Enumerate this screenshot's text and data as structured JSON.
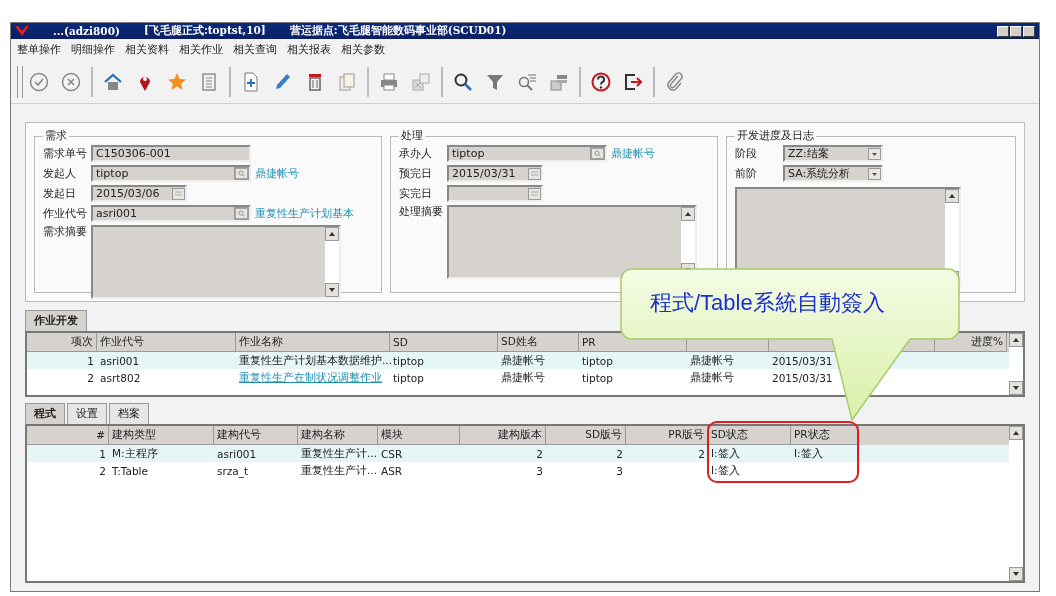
{
  "window": {
    "title": [
      "...(adzi800)",
      "[飞毛腿正式:toptst,10]",
      "营运据点:飞毛腿智能数码事业部(SCUD01)"
    ]
  },
  "menu": [
    "整单操作",
    "明细操作",
    "相关资料",
    "相关作业",
    "相关查询",
    "相关报表",
    "相关参数"
  ],
  "toolbar": [
    [
      {
        "kind": "confirm"
      },
      {
        "kind": "cancel"
      }
    ],
    [
      {
        "kind": "home"
      },
      {
        "kind": "pin"
      },
      {
        "kind": "star"
      },
      {
        "kind": "list"
      }
    ],
    [
      {
        "kind": "add"
      },
      {
        "kind": "edit"
      },
      {
        "kind": "delete"
      },
      {
        "kind": "copy"
      }
    ],
    [
      {
        "kind": "print"
      },
      {
        "kind": "export"
      }
    ],
    [
      {
        "kind": "search"
      },
      {
        "kind": "filter"
      },
      {
        "kind": "query-list"
      },
      {
        "kind": "stack"
      }
    ],
    [
      {
        "kind": "help"
      },
      {
        "kind": "exit"
      }
    ],
    [
      {
        "kind": "attach"
      }
    ]
  ],
  "sections": [
    {
      "title": "需求",
      "fields": [
        {
          "kind": "text",
          "label": "需求单号",
          "value": "C150306-001"
        },
        {
          "kind": "lookup",
          "label": "发起人",
          "value": "tiptop",
          "link": "鼎捷帐号"
        },
        {
          "kind": "date",
          "label": "发起日",
          "value": "2015/03/06"
        },
        {
          "kind": "lookup",
          "label": "作业代号",
          "value": "asri001",
          "link": "重复性生产计划基本"
        },
        {
          "kind": "memo",
          "label": "需求摘要"
        }
      ]
    },
    {
      "title": "处理",
      "fields": [
        {
          "kind": "lookup",
          "label": "承办人",
          "value": "tiptop",
          "link": "鼎捷帐号"
        },
        {
          "kind": "date",
          "label": "预完日",
          "value": "2015/03/31"
        },
        {
          "kind": "date",
          "label": "实完日"
        },
        {
          "kind": "memo",
          "label": "处理摘要"
        }
      ]
    },
    {
      "title": "开发进度及日志",
      "fields": [
        {
          "kind": "select",
          "label": "阶段",
          "value": "ZZ:结案"
        },
        {
          "kind": "select",
          "label": "前阶",
          "value": "SA:系统分析"
        },
        {
          "kind": "memo"
        }
      ]
    }
  ],
  "job_tabs": [
    {
      "label": "作业开发",
      "selected": true
    }
  ],
  "job_table": {
    "columns": [
      "项次",
      "作业代号",
      "作业名称",
      "SD",
      "SD姓名",
      "PR",
      "",
      "",
      "",
      "进度%"
    ],
    "rows": [
      {
        "selected": true,
        "cells": [
          "1",
          "asri001",
          "重复性生产计划基本数据维护...",
          "tiptop",
          "鼎捷帐号",
          "tiptop",
          "鼎捷帐号",
          "2015/03/31",
          "",
          ""
        ],
        "link_cell": false
      },
      {
        "selected": false,
        "cells": [
          "2",
          "asrt802",
          "重复性生产在制状况调整作业",
          "tiptop",
          "鼎捷帐号",
          "tiptop",
          "鼎捷帐号",
          "2015/03/31",
          "",
          ""
        ],
        "link_cell": true
      }
    ]
  },
  "detail_tabs": [
    {
      "label": "程式",
      "selected": true
    },
    {
      "label": "设置",
      "selected": false
    },
    {
      "label": "档案",
      "selected": false
    }
  ],
  "detail_table": {
    "columns": [
      "#",
      "建构类型",
      "建构代号",
      "建构名称",
      "模块",
      "建构版本",
      "SD版号",
      "PR版号",
      "SD状态",
      "PR状态"
    ],
    "rows": [
      {
        "selected": true,
        "cells": [
          "1",
          "M:主程序",
          "asri001",
          "重复性生产计...",
          "CSR",
          "2",
          "2",
          "2",
          "I:签入",
          "I:签入"
        ]
      },
      {
        "selected": false,
        "cells": [
          "2",
          "T:Table",
          "srza_t",
          "重复性生产计...",
          "ASR",
          "3",
          "3",
          "",
          "I:签入",
          ""
        ]
      }
    ]
  },
  "callout": {
    "text": "程式/Table系統自動簽入"
  }
}
